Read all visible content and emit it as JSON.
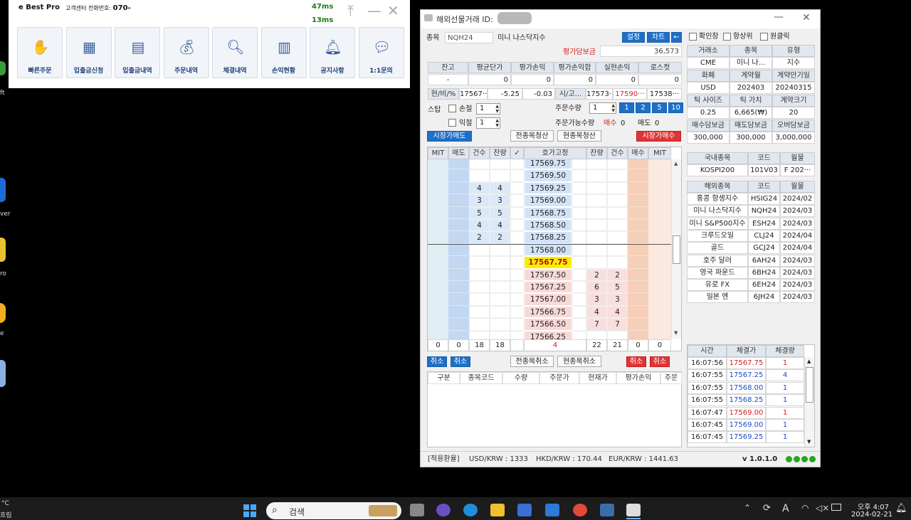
{
  "desktop": {
    "labels": [
      "ft",
      "ver",
      "ro",
      "e"
    ]
  },
  "launcher": {
    "brand": "e Best Pro",
    "support_label": "고객센터 전화번호:",
    "support_number": "070-",
    "ping1": "47ms",
    "ping2": "13ms",
    "buttons": [
      {
        "label": "빠른주문",
        "icon": "hand-coin-icon"
      },
      {
        "label": "입출금신청",
        "icon": "card-request-icon"
      },
      {
        "label": "입출금내역",
        "icon": "receipt-icon"
      },
      {
        "label": "주문내역",
        "icon": "money-bag-icon"
      },
      {
        "label": "체결내역",
        "icon": "search-doc-icon"
      },
      {
        "label": "손익현황",
        "icon": "bar-chart-icon"
      },
      {
        "label": "공지사항",
        "icon": "bell-icon"
      },
      {
        "label": "1:1문의",
        "icon": "chat-icon"
      }
    ]
  },
  "window": {
    "title": "해외선물거래",
    "id_label": "ID:",
    "symbol_label": "종목",
    "symbol_code": "NQH24",
    "symbol_name": "미니 나스닥지수",
    "btn_settings": "설정",
    "btn_chart": "차트",
    "btn_back": "←",
    "margin_label": "평가담보금",
    "margin_value": "36,573",
    "pos_headers": [
      "잔고",
      "평균단가",
      "평가손익",
      "평가손익합",
      "실현손익",
      "로스컷"
    ],
    "pos_values": [
      "-",
      "0",
      "0",
      "0",
      "0",
      "0"
    ],
    "quote_label": "현/비/%",
    "quote_price": "17567···",
    "quote_change": "-5.25",
    "quote_pct": "-0.03",
    "quote_label2": "시/고...",
    "quote_open": "17573···",
    "quote_high": "17590···",
    "quote_low": "17538···",
    "stop_label": "스탑",
    "loss_label": "손절",
    "loss_val": "1",
    "profit_label": "익절",
    "profit_val": "1",
    "qty_label": "주문수량",
    "qty_val": "1",
    "qty_btns": [
      "1",
      "2",
      "5",
      "10"
    ],
    "avail_label": "주문가능수량",
    "avail_buy_label": "매수",
    "avail_buy": "0",
    "avail_sell_label": "매도",
    "avail_sell": "0",
    "btn_market_sell": "시장가매도",
    "btn_all_close": "전종목청산",
    "btn_cur_close": "현종목청산",
    "btn_market_buy": "시장가매수",
    "ob_headers": [
      "MIT",
      "매도",
      "건수",
      "잔량",
      "✓",
      "호가고정",
      "잔량",
      "건수",
      "매수",
      "MIT"
    ],
    "ob_rows": [
      {
        "p": "17569.75",
        "sc": "",
        "sq": "",
        "bq": "",
        "bc": ""
      },
      {
        "p": "17569.50",
        "sc": "",
        "sq": "",
        "bq": "",
        "bc": ""
      },
      {
        "p": "17569.25",
        "sc": "4",
        "sq": "4",
        "bq": "",
        "bc": ""
      },
      {
        "p": "17569.00",
        "sc": "3",
        "sq": "3",
        "bq": "",
        "bc": ""
      },
      {
        "p": "17568.75",
        "sc": "5",
        "sq": "5",
        "bq": "",
        "bc": ""
      },
      {
        "p": "17568.50",
        "sc": "4",
        "sq": "4",
        "bq": "",
        "bc": ""
      },
      {
        "p": "17568.25",
        "sc": "2",
        "sq": "2",
        "bq": "",
        "bc": ""
      },
      {
        "p": "17568.00",
        "sc": "",
        "sq": "",
        "bq": "",
        "bc": ""
      },
      {
        "p": "17567.75",
        "sc": "",
        "sq": "",
        "bq": "",
        "bc": ""
      },
      {
        "p": "17567.50",
        "sc": "",
        "sq": "",
        "bq": "2",
        "bc": "2"
      },
      {
        "p": "17567.25",
        "sc": "",
        "sq": "",
        "bq": "6",
        "bc": "5"
      },
      {
        "p": "17567.00",
        "sc": "",
        "sq": "",
        "bq": "3",
        "bc": "3"
      },
      {
        "p": "17566.75",
        "sc": "",
        "sq": "",
        "bq": "4",
        "bc": "4"
      },
      {
        "p": "17566.50",
        "sc": "",
        "sq": "",
        "bq": "7",
        "bc": "7"
      },
      {
        "p": "17566.25",
        "sc": "",
        "sq": "",
        "bq": "",
        "bc": ""
      }
    ],
    "ob_totals": [
      "0",
      "0",
      "18",
      "18",
      "",
      "4",
      "22",
      "21",
      "0",
      "0"
    ],
    "btn_cancel": "취소",
    "btn_all_cancel": "전종목취소",
    "btn_cur_cancel": "현종목취소",
    "ord_headers": [
      "구분",
      "종목코드",
      "수량",
      "주문가",
      "현재가",
      "평가손익",
      "주문"
    ],
    "footer_label": "[적용환율]",
    "fx_usd": "USD/KRW : 1333",
    "fx_hkd": "HKD/KRW : 170.44",
    "fx_eur": "EUR/KRW : 1441.63",
    "version": "v 1.0.1.0",
    "opt_confirm": "확인창",
    "opt_top": "항상위",
    "opt_click": "원클릭",
    "info_headers1": [
      "거래소",
      "종목",
      "유형"
    ],
    "info_values1": [
      "CME",
      "미니 나...",
      "지수"
    ],
    "info_headers2": [
      "화폐",
      "계약월",
      "계약만기일"
    ],
    "info_values2": [
      "USD",
      "202403",
      "20240315"
    ],
    "info_headers3": [
      "틱 사이즈",
      "틱 가치",
      "계약크기"
    ],
    "info_values3": [
      "0.25",
      "6,665(₩)",
      "20"
    ],
    "info_headers4": [
      "매수담보금",
      "매도담보금",
      "오버담보금"
    ],
    "info_values4": [
      "300,000",
      "300,000",
      "3,000,000"
    ],
    "dom_headers": [
      "국내종목",
      "코드",
      "월물"
    ],
    "dom_rows": [
      [
        "KOSPI200",
        "101V03",
        "F 202···"
      ]
    ],
    "ovs_headers": [
      "해외종목",
      "코드",
      "월물"
    ],
    "ovs_rows": [
      [
        "홍콩 항셍지수",
        "HSIG24",
        "2024/02"
      ],
      [
        "미니 나스닥지수",
        "NQH24",
        "2024/03"
      ],
      [
        "미니 S&P500지수",
        "ESH24",
        "2024/03"
      ],
      [
        "크루드오일",
        "CLJ24",
        "2024/04"
      ],
      [
        "골드",
        "GCJ24",
        "2024/04"
      ],
      [
        "호주 달러",
        "6AH24",
        "2024/03"
      ],
      [
        "영국 파운드",
        "6BH24",
        "2024/03"
      ],
      [
        "유로 FX",
        "6EH24",
        "2024/03"
      ],
      [
        "일본 엔",
        "6JH24",
        "2024/03"
      ]
    ],
    "tick_headers": [
      "시간",
      "체결가",
      "체결량"
    ],
    "ticks": [
      {
        "t": "16:07:56",
        "p": "17567.75",
        "q": "1",
        "c": "red"
      },
      {
        "t": "16:07:55",
        "p": "17567.25",
        "q": "4",
        "c": "blue"
      },
      {
        "t": "16:07:55",
        "p": "17568.00",
        "q": "1",
        "c": "blue"
      },
      {
        "t": "16:07:55",
        "p": "17568.25",
        "q": "1",
        "c": "blue"
      },
      {
        "t": "16:07:47",
        "p": "17569.00",
        "q": "1",
        "c": "red"
      },
      {
        "t": "16:07:45",
        "p": "17569.00",
        "q": "1",
        "c": "blue"
      },
      {
        "t": "16:07:45",
        "p": "17569.25",
        "q": "1",
        "c": "blue"
      }
    ]
  },
  "taskbar": {
    "search": "검색",
    "time": "오후 4:07",
    "date": "2024-02-21",
    "weather_temp": "°C",
    "weather_text": "흐림"
  }
}
